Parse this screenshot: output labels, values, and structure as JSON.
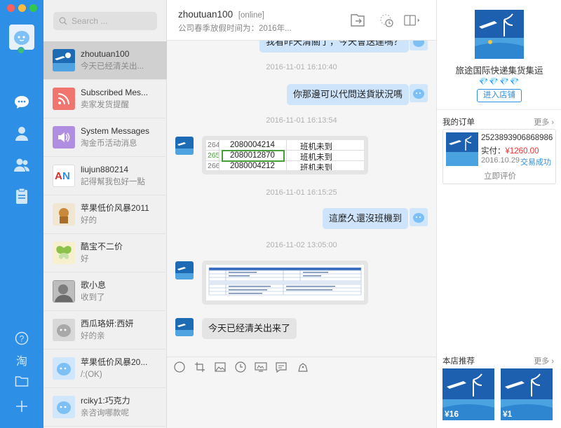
{
  "app": {
    "window_buttons": [
      "close",
      "minimize",
      "zoom"
    ]
  },
  "colors": {
    "accent": "#2e8fe6",
    "rail": "#2e8fe6",
    "bubble_out": "#cde4fa",
    "bubble_in": "#e4e4e4",
    "price": "#ee3333",
    "online": "#3fc07a"
  },
  "rail": {
    "icons": [
      "user-avatar",
      "chat-icon",
      "contact-icon",
      "group-icon",
      "clipboard-icon",
      "help-icon",
      "taobao-icon",
      "folder-icon",
      "plus-icon"
    ],
    "taobao_label": "淘"
  },
  "search": {
    "placeholder": "Search ..."
  },
  "conversations": [
    {
      "name": "zhoutuan100",
      "preview": "今天已经清关出...",
      "active": true
    },
    {
      "name": "Subscribed Mes...",
      "preview": "卖家发货提醒"
    },
    {
      "name": "System Messages",
      "preview": "淘金币活动消息"
    },
    {
      "name": "liujun880214",
      "preview": "記得幫我包好一點"
    },
    {
      "name": "苹果低价风暴2011",
      "preview": "好的"
    },
    {
      "name": "酷宝不二价",
      "preview": "好"
    },
    {
      "name": "歌小息",
      "preview": "收到了"
    },
    {
      "name": "西瓜珞妍:西妍",
      "preview": "好的亲"
    },
    {
      "name": "苹果低价风暴20...",
      "preview": "/:(OK)"
    },
    {
      "name": "rciky1:巧克力",
      "preview": "亲咨询哪款呢"
    }
  ],
  "chat": {
    "title": "zhoutuan100",
    "status": "[online]",
    "subtitle": "公司春季放假时间为：2016年...",
    "messages": [
      {
        "type": "text",
        "side": "right",
        "text": "我看昨天清關了，今天會送達嗎？"
      },
      {
        "type": "time",
        "text": "2016-11-01 16:10:40"
      },
      {
        "type": "text",
        "side": "right",
        "text": "你那邊可以代問送貨狀況嗎"
      },
      {
        "type": "time",
        "text": "2016-11-01 16:13:54"
      },
      {
        "type": "image-table",
        "side": "left",
        "rows": [
          {
            "idx": "264",
            "code": "2080004214",
            "note": "班机未到"
          },
          {
            "idx": "265",
            "code": "2080012870",
            "note": "班机未到"
          },
          {
            "idx": "266",
            "code": "2080004212",
            "note": "班机未到"
          }
        ]
      },
      {
        "type": "time",
        "text": "2016-11-01 16:15:25"
      },
      {
        "type": "text",
        "side": "right",
        "text": "這麼久還沒班機到"
      },
      {
        "type": "time",
        "text": "2016-11-02 13:05:00"
      },
      {
        "type": "image-form",
        "side": "left"
      },
      {
        "type": "text",
        "side": "left",
        "text": "今天已经清关出来了"
      }
    ]
  },
  "toolbar": {
    "icons": [
      "emoji-icon",
      "crop-icon",
      "image-icon",
      "clock-icon",
      "video-icon",
      "quick-reply-icon",
      "coupon-icon"
    ]
  },
  "shop": {
    "name": "旅途国际快递集货集运",
    "rank": "💎💎💎💎",
    "enter_button": "进入店铺",
    "orders_title": "我的订单",
    "more": "更多",
    "order": {
      "id": "2523893906868986",
      "paid_label": "实付：",
      "paid": "¥1260.00",
      "date": "2016.10.29",
      "state": "交易成功",
      "review": "立即评价"
    },
    "rec_title": "本店推荐",
    "recommendations": [
      {
        "price": "¥16"
      },
      {
        "price": "¥1"
      }
    ]
  }
}
